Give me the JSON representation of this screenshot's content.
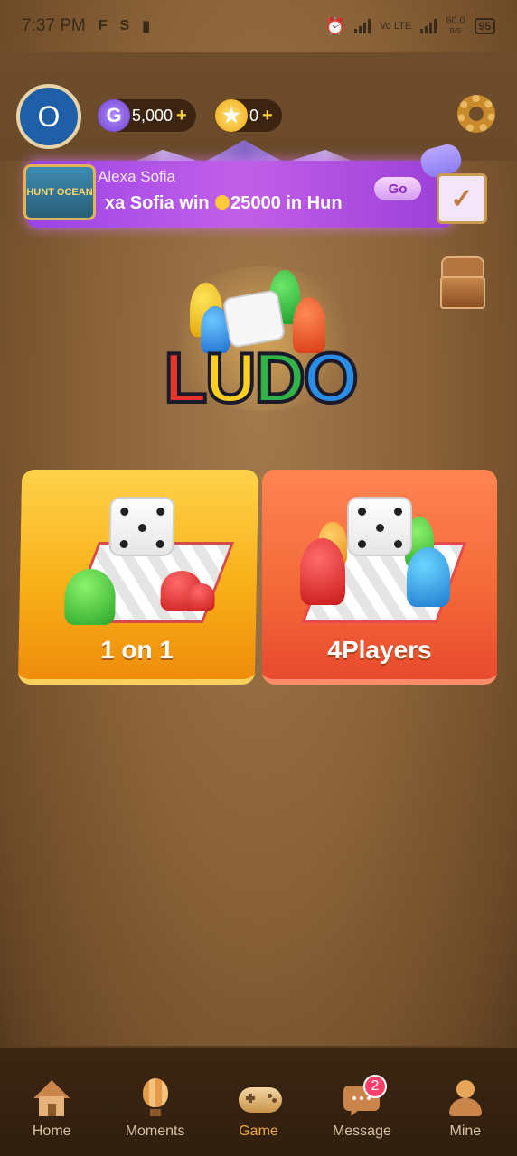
{
  "status": {
    "time": "7:37 PM",
    "network": "Vo LTE",
    "speed": "60.0",
    "speed_unit": "B/S",
    "battery": "95"
  },
  "header": {
    "avatar_initial": "O",
    "gems": "5,000",
    "coins": "0",
    "add_symbol": "+"
  },
  "banner": {
    "game_name": "HUNT OCEAN",
    "user": "Alexa Sofia",
    "message_prefix": "xa Sofia win ",
    "message_amount": "25000",
    "message_suffix": " in Hun",
    "go_label": "Go"
  },
  "logo": {
    "letters": [
      "L",
      "U",
      "D",
      "O"
    ]
  },
  "modes": [
    {
      "label": "1 on 1",
      "color": "#f8b018"
    },
    {
      "label": "4Players",
      "color": "#f46a3a"
    }
  ],
  "nav": [
    {
      "label": "Home",
      "icon": "home-icon"
    },
    {
      "label": "Moments",
      "icon": "balloon-icon"
    },
    {
      "label": "Game",
      "icon": "gamepad-icon",
      "active": true
    },
    {
      "label": "Message",
      "icon": "chat-icon",
      "badge": "2"
    },
    {
      "label": "Mine",
      "icon": "person-icon"
    }
  ],
  "colors": {
    "accent": "#f3a83a",
    "nav_bg": "#301e0e",
    "badge": "#ff3f6a"
  }
}
